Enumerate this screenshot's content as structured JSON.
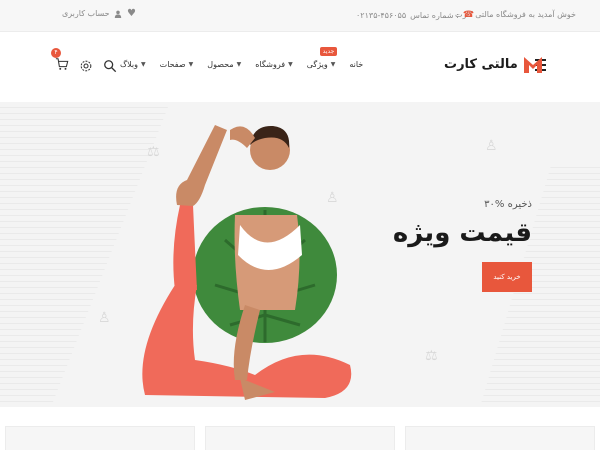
{
  "topbar": {
    "welcome": "خوش آمدید به فروشگاه مالتی کارت",
    "phone_label": "شماره تماس :",
    "phone_number": "۰۲۱۳۵-۴۵۶۰۵۵",
    "account_label": "حساب کاربری"
  },
  "header": {
    "logo_text": "مالتی کارت",
    "nav": [
      {
        "label": "خانه",
        "has_dropdown": false
      },
      {
        "label": "ویژگی",
        "has_dropdown": true,
        "badge": "جدید"
      },
      {
        "label": "فروشگاه",
        "has_dropdown": true
      },
      {
        "label": "محصول",
        "has_dropdown": true
      },
      {
        "label": "صفحات",
        "has_dropdown": true
      },
      {
        "label": "وبلاگ",
        "has_dropdown": true
      }
    ],
    "cart_count": "۴"
  },
  "hero": {
    "subtitle": "۳۰% ذخیره",
    "title": "قیمت ویژه",
    "button": "خرید کنید"
  },
  "colors": {
    "accent": "#e8573c",
    "hero_bg": "#f4f4f4",
    "topbar_bg": "#f7f7f7"
  },
  "icons": [
    "menu-icon",
    "phone-icon",
    "user-icon",
    "heart-icon",
    "search-icon",
    "settings-icon",
    "cart-icon",
    "chevron-down-icon",
    "logo-m-icon"
  ]
}
